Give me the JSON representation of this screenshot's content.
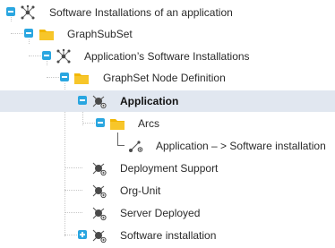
{
  "tree": {
    "nodes": [
      {
        "label": "Software Installations of an application",
        "icon": "graph-network-icon",
        "expander": "minus"
      },
      {
        "label": "GraphSubSet",
        "icon": "folder-icon",
        "expander": "minus"
      },
      {
        "label": "Application’s Software Installations",
        "icon": "graph-network-icon",
        "expander": "minus"
      },
      {
        "label": "GraphSet Node Definition",
        "icon": "folder-icon",
        "expander": "minus"
      },
      {
        "label": "Application",
        "icon": "node-definition-icon",
        "expander": "minus",
        "selected": true
      },
      {
        "label": "Arcs",
        "icon": "folder-icon",
        "expander": "minus"
      },
      {
        "label": "Application – > Software installation",
        "icon": "arc-icon"
      },
      {
        "label": "Deployment Support",
        "icon": "node-definition-icon"
      },
      {
        "label": "Org-Unit",
        "icon": "node-definition-icon"
      },
      {
        "label": "Server Deployed",
        "icon": "node-definition-icon"
      },
      {
        "label": "Software installation",
        "icon": "node-definition-icon",
        "expander": "plus"
      }
    ]
  },
  "colors": {
    "selection_bg": "#e1e7f0",
    "expander": "#2aa6e0",
    "folder": "#f2b705",
    "icon_dark": "#4a4a4a"
  }
}
